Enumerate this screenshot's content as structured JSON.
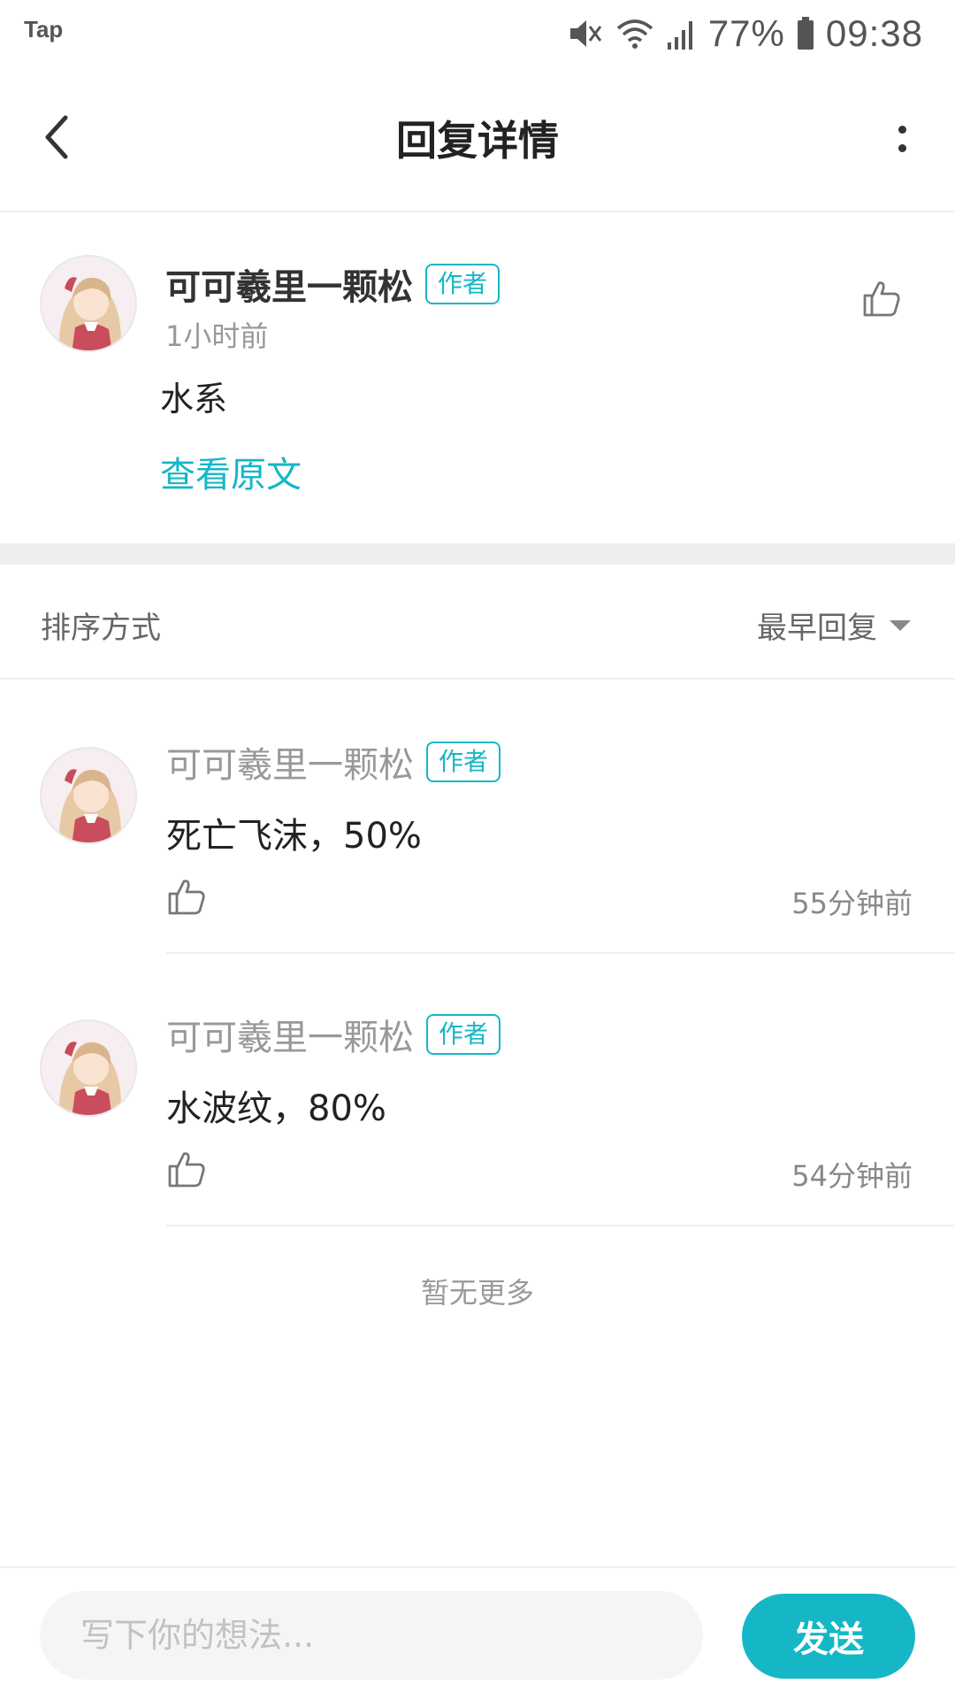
{
  "status_bar": {
    "app_label": "Tap",
    "battery": "77%",
    "time": "09:38",
    "icons": [
      "mute-icon",
      "wifi-icon",
      "signal-icon",
      "battery-icon"
    ]
  },
  "header": {
    "title": "回复详情",
    "back_icon": "chevron-left-icon",
    "more_icon": "more-vertical-icon"
  },
  "post": {
    "author": "可可羲里一颗松",
    "badge": "作者",
    "time": "1小时前",
    "content": "水系",
    "view_original": "查看原文"
  },
  "sort": {
    "label": "排序方式",
    "selected": "最早回复"
  },
  "replies": [
    {
      "author": "可可羲里一颗松",
      "badge": "作者",
      "content": "死亡飞沫，50%",
      "time": "55分钟前"
    },
    {
      "author": "可可羲里一颗松",
      "badge": "作者",
      "content": "水波纹，80%",
      "time": "54分钟前"
    }
  ],
  "footer": {
    "no_more": "暂无更多"
  },
  "input_bar": {
    "placeholder": "写下你的想法...",
    "send_label": "发送"
  },
  "colors": {
    "accent": "#15b7c6",
    "divider": "#eeeeee",
    "muted_text": "#999999"
  }
}
